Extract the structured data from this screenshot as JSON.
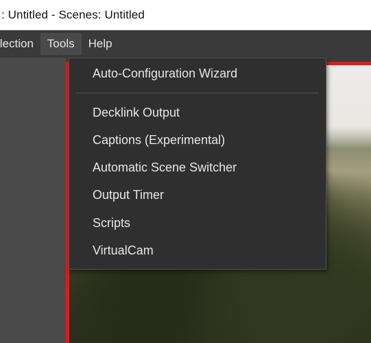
{
  "window": {
    "title": ": Untitled - Scenes: Untitled"
  },
  "menubar": {
    "items": [
      {
        "label": "llection"
      },
      {
        "label": "Tools"
      },
      {
        "label": "Help"
      }
    ]
  },
  "tools_menu": {
    "items": [
      {
        "label": "Auto-Configuration Wizard"
      },
      {
        "label": "Decklink Output"
      },
      {
        "label": "Captions (Experimental)"
      },
      {
        "label": "Automatic Scene Switcher"
      },
      {
        "label": "Output Timer"
      },
      {
        "label": "Scripts"
      },
      {
        "label": "VirtualCam"
      }
    ]
  },
  "colors": {
    "menubar_bg": "#3a3a3a",
    "menu_bg": "#2f2f2f",
    "selection_border": "#d42020"
  }
}
